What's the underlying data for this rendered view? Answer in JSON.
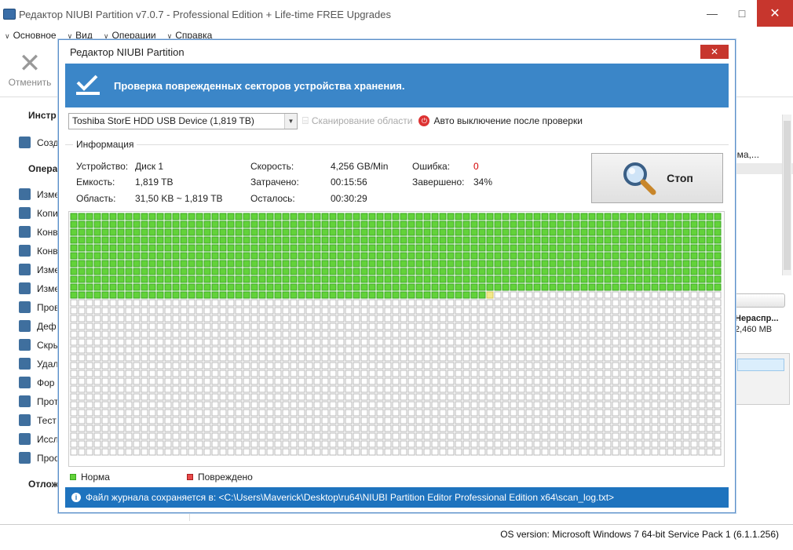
{
  "window": {
    "title": "Редактор NIUBI Partition v7.0.7 - Professional Edition + Life-time FREE Upgrades",
    "min_glyph": "—",
    "max_glyph": "□",
    "close_glyph": "✕"
  },
  "menu": [
    "Основное",
    "Вид",
    "Операции",
    "Справка"
  ],
  "toolbar": {
    "undo_label": "Отменить"
  },
  "sidebar": {
    "heads": [
      "Инстр",
      "Опера",
      "Отлож"
    ],
    "create_item": "Созд",
    "items": [
      "Изме",
      "Копи",
      "Конв",
      "Конв",
      "Изме",
      "Изме",
      "Пров",
      "Деф",
      "Скры",
      "Удал",
      "Фор",
      "Прот",
      "Тест",
      "Иссл",
      "Прос"
    ]
  },
  "right_panel": {
    "text1": "ема,...",
    "unalloc_label": "Нераспр...",
    "unalloc_size": "2,460 MB"
  },
  "status": {
    "os_version": "OS version: Microsoft Windows 7  64-bit Service Pack 1 (6.1.1.256)"
  },
  "dialog": {
    "title": "Редактор NIUBI Partition",
    "close_glyph": "✕",
    "banner": "Проверка поврежденных секторов устройства хранения.",
    "device": "Toshiba StorE HDD USB Device (1,819 TB)",
    "scan_area": "Сканирование области",
    "auto_off": "Авто выключение после проверки",
    "info_legend": "Информация",
    "info": {
      "device_label": "Устройство:",
      "device_value": "Диск 1",
      "capacity_label": "Емкость:",
      "capacity_value": "1,819 TB",
      "area_label": "Область:",
      "area_value": "31,50 KB ~ 1,819 TB",
      "speed_label": "Скорость:",
      "speed_value": "4,256 GB/Min",
      "elapsed_label": "Затрачено:",
      "elapsed_value": "00:15:56",
      "remaining_label": "Осталось:",
      "remaining_value": "00:30:29",
      "error_label": "Ошибка:",
      "error_value": "0",
      "done_label": "Завершено:",
      "done_value": "34%"
    },
    "stop_label": "Стоп",
    "legend_normal": "Норма",
    "legend_damaged": "Повреждено",
    "log_text": "Файл журнала сохраняется в: <C:\\Users\\Maverick\\Desktop\\ru64\\NIUBI Partition Editor Professional Edition x64\\scan_log.txt>"
  },
  "scan_grid": {
    "columns": 83,
    "rows": 31,
    "completed_blocks": 883,
    "current_block": 884,
    "total_blocks": 2573,
    "colors": {
      "normal": "#63d23a",
      "normal_border": "#3aa820",
      "pending_border": "#b8b8b8",
      "current": "#f2e98a",
      "damaged": "#e84a4a"
    }
  },
  "colors": {
    "banner": "#3b86c8",
    "logbar": "#1e73be",
    "close_red": "#c7362d"
  }
}
